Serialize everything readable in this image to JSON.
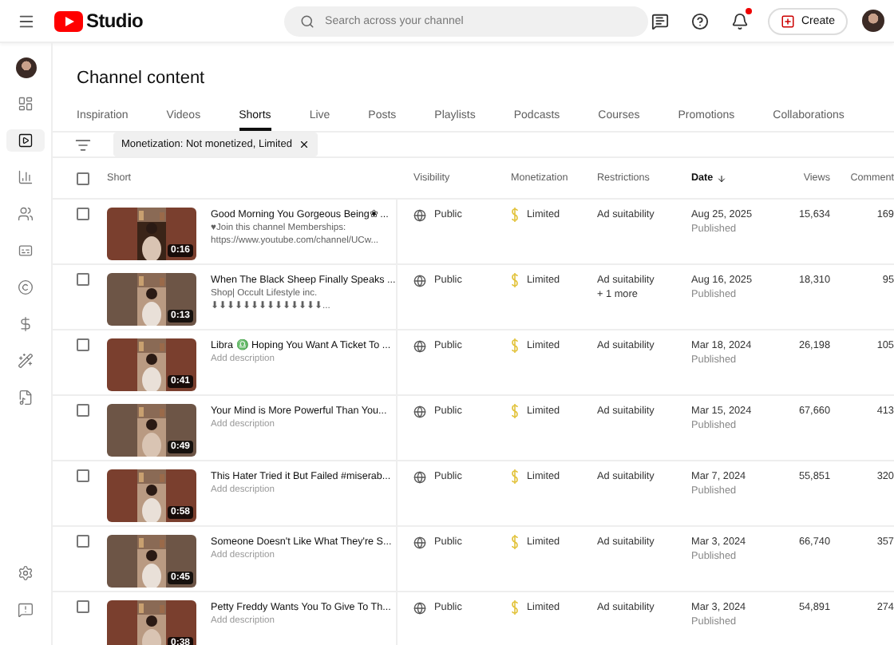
{
  "header": {
    "logo_text": "Studio",
    "search": {
      "placeholder": "Search across your channel"
    },
    "create_button": "Create",
    "notification_badge": true
  },
  "page": {
    "title": "Channel content"
  },
  "sidebar": {
    "items": [
      {
        "kind": "dashboard",
        "selected": false
      },
      {
        "kind": "content",
        "selected": true
      },
      {
        "kind": "analytics",
        "selected": false
      },
      {
        "kind": "community",
        "selected": false
      },
      {
        "kind": "subtitles",
        "selected": false
      },
      {
        "kind": "copyright",
        "selected": false
      },
      {
        "kind": "earn",
        "selected": false
      },
      {
        "kind": "customization",
        "selected": false
      },
      {
        "kind": "audio",
        "selected": false
      }
    ],
    "bottom_items": [
      {
        "kind": "settings"
      },
      {
        "kind": "feedback"
      }
    ]
  },
  "tabs": [
    {
      "label": "Inspiration",
      "selected": false
    },
    {
      "label": "Videos",
      "selected": false
    },
    {
      "label": "Shorts",
      "selected": true
    },
    {
      "label": "Live",
      "selected": false
    },
    {
      "label": "Posts",
      "selected": false
    },
    {
      "label": "Playlists",
      "selected": false
    },
    {
      "label": "Podcasts",
      "selected": false
    },
    {
      "label": "Courses",
      "selected": false
    },
    {
      "label": "Promotions",
      "selected": false
    },
    {
      "label": "Collaborations",
      "selected": false
    }
  ],
  "filter_chip": "Monetization: Not monetized, Limited",
  "table": {
    "select_all": {
      "checked": false
    },
    "columns": [
      {
        "label": "Short",
        "sorted": false
      },
      {
        "label": "Visibility",
        "sorted": false
      },
      {
        "label": "Monetization",
        "sorted": false
      },
      {
        "label": "Restrictions",
        "sorted": false
      },
      {
        "label": "Date",
        "sorted": true
      },
      {
        "label": "Views",
        "sorted": false
      },
      {
        "label": "Comment",
        "sorted": false
      }
    ],
    "rows": [
      {
        "checked": false,
        "duration": "0:16",
        "title": "Good Morning You Gorgeous Being❀ ...",
        "description": [
          "♥Join this channel Memberships:",
          "https://www.youtube.com/channel/UCw..."
        ],
        "description_empty": false,
        "visibility": "Public",
        "monetization": "Limited",
        "restrictions": [
          "Ad suitability"
        ],
        "date": "Aug 25, 2025",
        "status": "Published",
        "views": "15,634",
        "comments": "169"
      },
      {
        "checked": false,
        "duration": "0:13",
        "title": "When The Black Sheep Finally Speaks ...",
        "description": [
          "Shop| Occult Lifestyle inc.",
          "⬇⬇⬇⬇⬇⬇⬇⬇⬇⬇⬇⬇⬇⬇..."
        ],
        "description_empty": false,
        "visibility": "Public",
        "monetization": "Limited",
        "restrictions": [
          "Ad suitability",
          "+ 1 more"
        ],
        "date": "Aug 16, 2025",
        "status": "Published",
        "views": "18,310",
        "comments": "95"
      },
      {
        "checked": false,
        "duration": "0:41",
        "title": "Libra ♎ Hoping You Want A Ticket To ...",
        "description": [
          "Add description"
        ],
        "description_empty": true,
        "visibility": "Public",
        "monetization": "Limited",
        "restrictions": [
          "Ad suitability"
        ],
        "date": "Mar 18, 2024",
        "status": "Published",
        "views": "26,198",
        "comments": "105"
      },
      {
        "checked": false,
        "duration": "0:49",
        "title": "Your Mind is More Powerful Than You...",
        "description": [
          "Add description"
        ],
        "description_empty": true,
        "visibility": "Public",
        "monetization": "Limited",
        "restrictions": [
          "Ad suitability"
        ],
        "date": "Mar 15, 2024",
        "status": "Published",
        "views": "67,660",
        "comments": "413"
      },
      {
        "checked": false,
        "duration": "0:58",
        "title": "This Hater Tried it But Failed #miserab...",
        "description": [
          "Add description"
        ],
        "description_empty": true,
        "visibility": "Public",
        "monetization": "Limited",
        "restrictions": [
          "Ad suitability"
        ],
        "date": "Mar 7, 2024",
        "status": "Published",
        "views": "55,851",
        "comments": "320"
      },
      {
        "checked": false,
        "duration": "0:45",
        "title": "Someone Doesn't Like What They're S...",
        "description": [
          "Add description"
        ],
        "description_empty": true,
        "visibility": "Public",
        "monetization": "Limited",
        "restrictions": [
          "Ad suitability"
        ],
        "date": "Mar 3, 2024",
        "status": "Published",
        "views": "66,740",
        "comments": "357"
      },
      {
        "checked": false,
        "duration": "0:38",
        "title": "Petty Freddy Wants You To Give To Th...",
        "description": [
          "Add description"
        ],
        "description_empty": true,
        "visibility": "Public",
        "monetization": "Limited",
        "restrictions": [
          "Ad suitability"
        ],
        "date": "Mar 3, 2024",
        "status": "Published",
        "views": "54,891",
        "comments": "274"
      }
    ]
  }
}
